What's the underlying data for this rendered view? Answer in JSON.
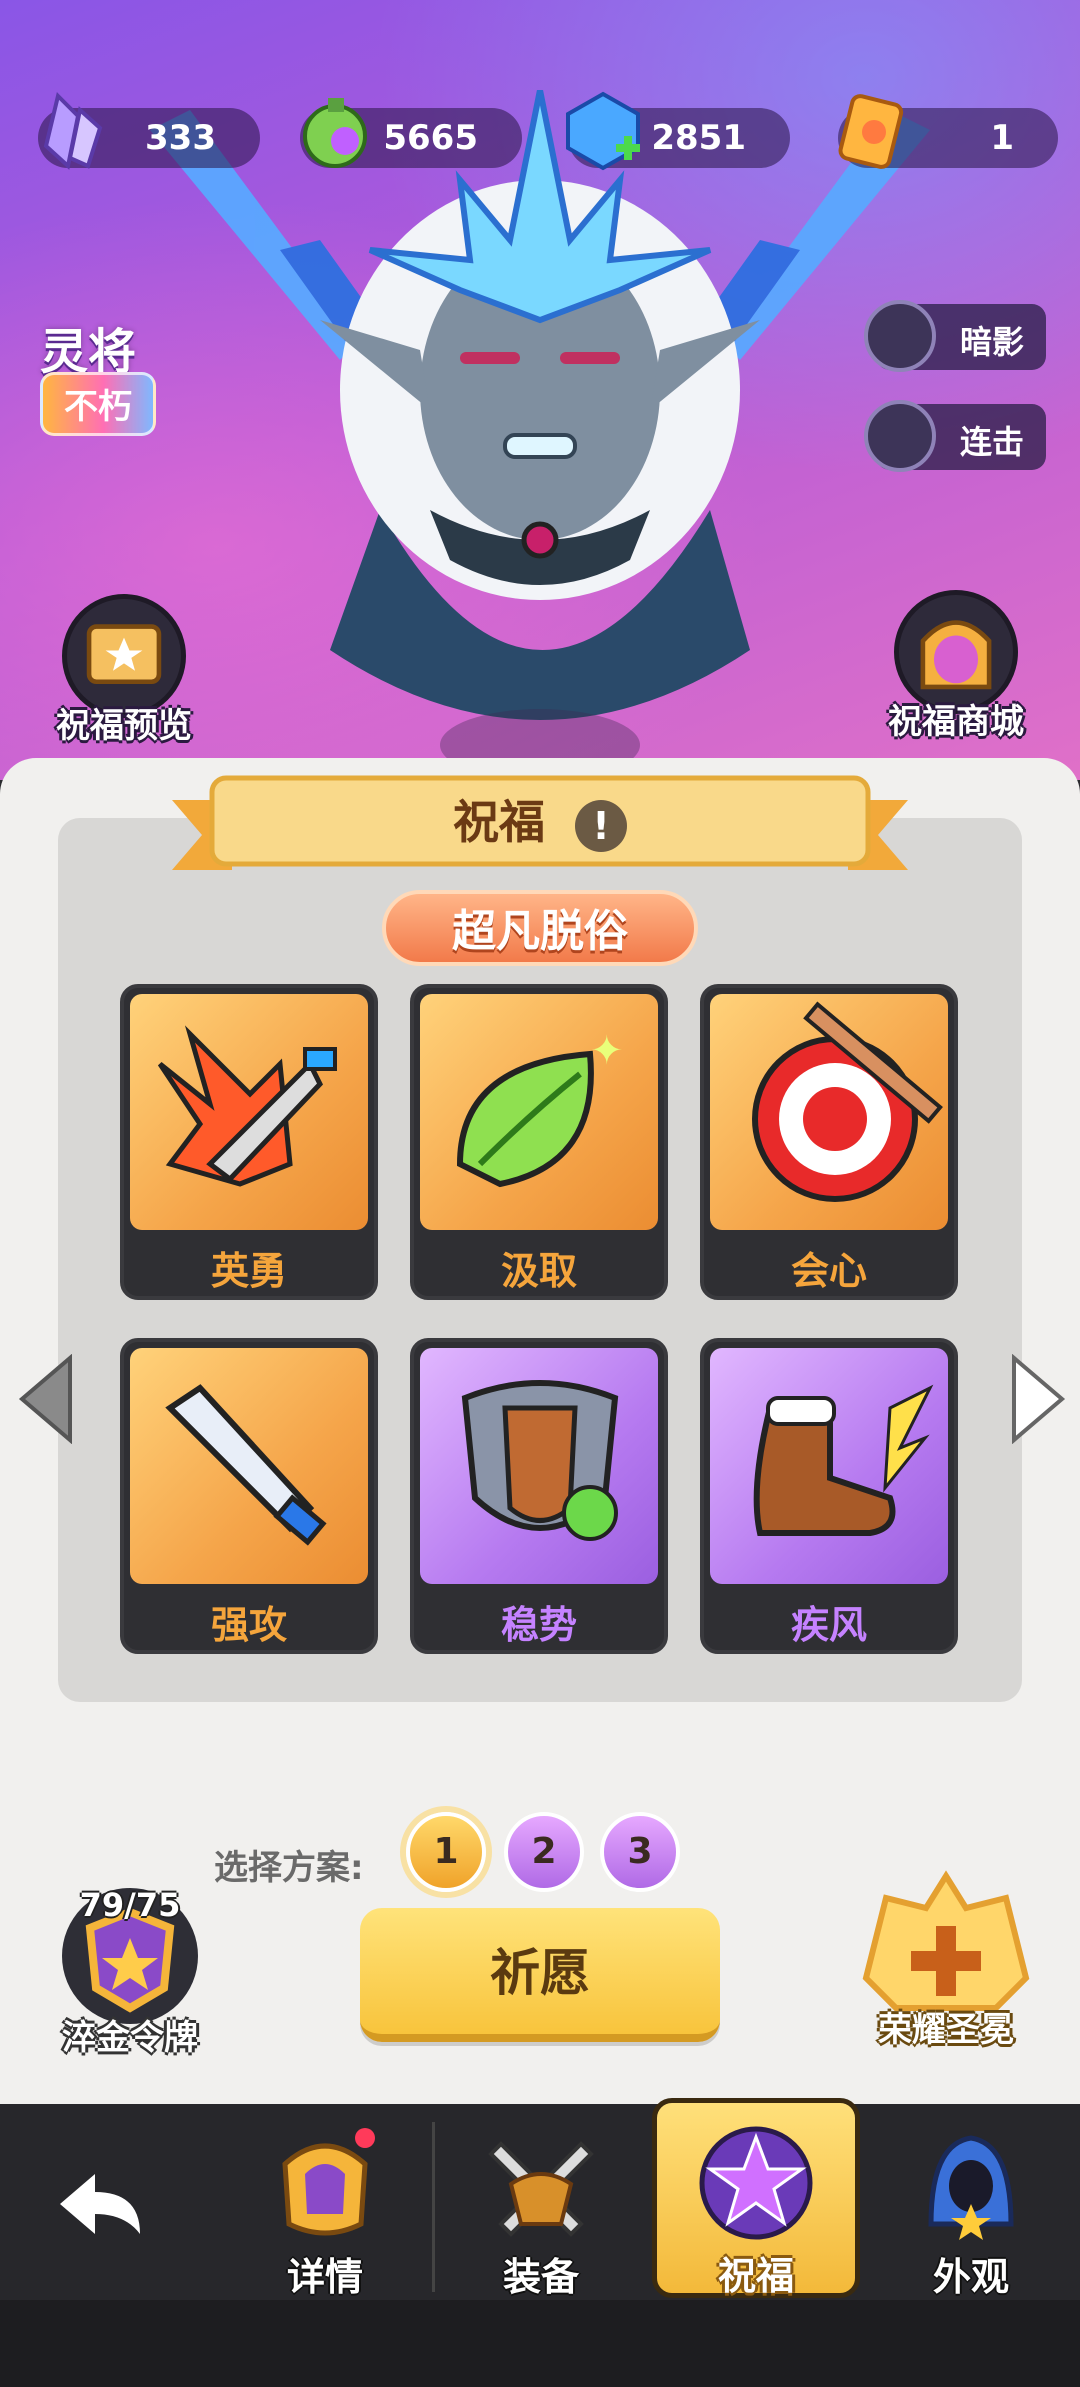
{
  "currencies": [
    {
      "icon": "crystal-icon",
      "value": "333"
    },
    {
      "icon": "potion-icon",
      "value": "5665"
    },
    {
      "icon": "gem-plus-icon",
      "value": "2851"
    },
    {
      "icon": "scroll-ticket-icon",
      "value": "1"
    }
  ],
  "hero": {
    "class_label": "灵将",
    "rarity_badge": "不朽",
    "skills": [
      "暗影",
      "连击"
    ],
    "left_button": "祝福预览",
    "right_button": "祝福商城"
  },
  "panel": {
    "title": "祝福",
    "info_icon": "!",
    "subtitle": "超凡脱俗",
    "cards": [
      {
        "label": "英勇",
        "tier": "gold",
        "icon": "arrow-burst-icon"
      },
      {
        "label": "汲取",
        "tier": "gold",
        "icon": "leaf-icon"
      },
      {
        "label": "会心",
        "tier": "gold",
        "icon": "target-icon"
      },
      {
        "label": "强攻",
        "tier": "gold",
        "icon": "sword-icon"
      },
      {
        "label": "稳势",
        "tier": "purple",
        "icon": "shield-icon"
      },
      {
        "label": "疾风",
        "tier": "purple",
        "icon": "boot-icon"
      }
    ],
    "plan_label": "选择方案:",
    "plans": [
      "1",
      "2",
      "3"
    ],
    "selected_plan": "1",
    "pray_button": "祈愿",
    "token_count": "79/75",
    "token_label": "淬金令牌",
    "crown_label": "荣耀圣冕"
  },
  "nav": {
    "items": [
      {
        "label": "详情",
        "icon": "helmet-icon"
      },
      {
        "label": "装备",
        "icon": "equipment-icon"
      },
      {
        "label": "祝福",
        "icon": "star-blessing-icon"
      },
      {
        "label": "外观",
        "icon": "hood-icon"
      }
    ],
    "active": "祝福"
  }
}
